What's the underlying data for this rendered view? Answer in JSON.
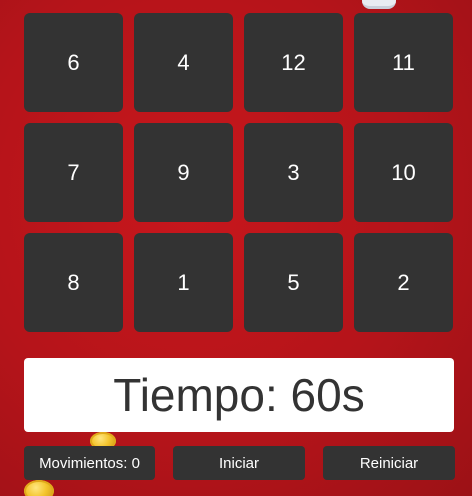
{
  "board": {
    "tiles": [
      "6",
      "4",
      "12",
      "11",
      "7",
      "9",
      "3",
      "10",
      "8",
      "1",
      "5",
      "2"
    ]
  },
  "timer": {
    "text": "Tiempo: 60s"
  },
  "controls": {
    "moves_text": "Movimientos: 0",
    "start_label": "Iniciar",
    "reset_label": "Reiniciar"
  },
  "colors": {
    "background": "#b5141a",
    "tile": "#333333",
    "text": "#ffffff"
  }
}
